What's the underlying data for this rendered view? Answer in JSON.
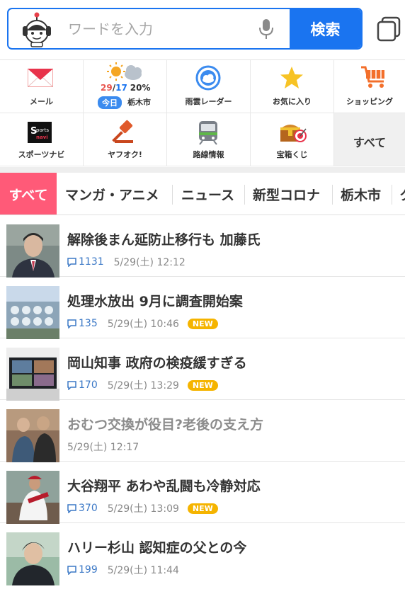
{
  "search": {
    "placeholder": "ワードを入力",
    "button_label": "検索"
  },
  "services": [
    {
      "label": "メール",
      "icon": "mail-icon"
    },
    {
      "label": "雨雲レーダー",
      "icon": "rain-radar-icon"
    },
    {
      "label": "お気に入り",
      "icon": "star-icon"
    },
    {
      "label": "ショッピング",
      "icon": "cart-icon"
    },
    {
      "label": "スポーツナビ",
      "icon": "sportsnavi-icon"
    },
    {
      "label": "ヤフオク!",
      "icon": "auction-gavel-icon"
    },
    {
      "label": "路線情報",
      "icon": "train-icon"
    },
    {
      "label": "宝箱くじ",
      "icon": "treasure-box-icon"
    }
  ],
  "weather": {
    "high": "29",
    "low": "17",
    "precip": "20%",
    "today_label": "今日",
    "city": "栃木市",
    "colors": {
      "high": "#e8554e",
      "low": "#1a74f0"
    }
  },
  "more_label": "すべて",
  "categories": [
    "すべて",
    "マンガ・アニメ",
    "ニュース",
    "新型コロナ",
    "栃木市",
    "ク"
  ],
  "news": [
    {
      "title": "解除後まん延防止移行も 加藤氏",
      "comments": "1131",
      "date": "5/29(土) 12:12",
      "new": "",
      "read": false
    },
    {
      "title": "処理水放出 9月に調査開始案",
      "comments": "135",
      "date": "5/29(土) 10:46",
      "new": "NEW",
      "read": false
    },
    {
      "title": "岡山知事 政府の検疫緩すぎる",
      "comments": "170",
      "date": "5/29(土) 13:29",
      "new": "NEW",
      "read": false
    },
    {
      "title": "おむつ交換が役目?老後の支え方",
      "comments": "",
      "date": "5/29(土) 12:17",
      "new": "",
      "read": true
    },
    {
      "title": "大谷翔平 あわや乱闘も冷静対応",
      "comments": "370",
      "date": "5/29(土) 13:09",
      "new": "NEW",
      "read": false
    },
    {
      "title": "ハリー杉山 認知症の父との今",
      "comments": "199",
      "date": "5/29(土) 11:44",
      "new": "",
      "read": false
    }
  ],
  "colors": {
    "accent": "#1a74f0",
    "category_active": "#ff5a78",
    "new_badge": "#f5b400"
  }
}
